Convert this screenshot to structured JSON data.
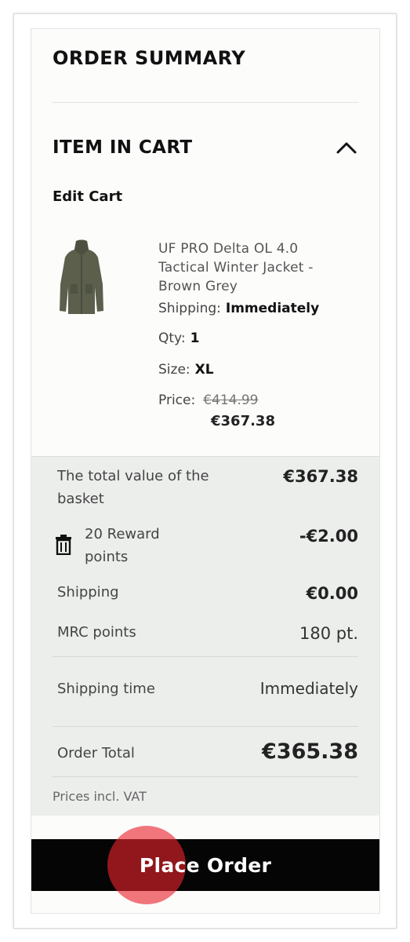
{
  "order_summary": {
    "title": "ORDER SUMMARY"
  },
  "cart": {
    "title": "ITEM IN CART",
    "expanded": true,
    "edit_label": "Edit Cart"
  },
  "product": {
    "name": "UF PRO Delta OL 4.0 Tactical Winter Jacket - Brown Grey",
    "image_icon": "jacket-image",
    "shipping_label": "Shipping:",
    "shipping_value": "Immediately",
    "qty_label": "Qty:",
    "qty_value": "1",
    "size_label": "Size:",
    "size_value": "XL",
    "price_label": "Price:",
    "original_price": "€414.99",
    "final_price": "€367.38"
  },
  "totals": {
    "basket_label": "The total value of the basket",
    "basket_value": "€367.38",
    "reward_label": "20 Reward points",
    "reward_value": "-€2.00",
    "shipping_label": "Shipping",
    "shipping_value": "€0.00",
    "mrc_label": "MRC points",
    "mrc_value": "180 pt.",
    "shipping_time_label": "Shipping time",
    "shipping_time_value": "Immediately",
    "order_total_label": "Order Total",
    "order_total_value": "€365.38",
    "vat_note": "Prices incl. VAT"
  },
  "actions": {
    "place_order_label": "Place Order"
  },
  "colors": {
    "button_bg": "#050505",
    "totals_bg": "#eceeec",
    "tap_indicator": "#e8232d"
  }
}
